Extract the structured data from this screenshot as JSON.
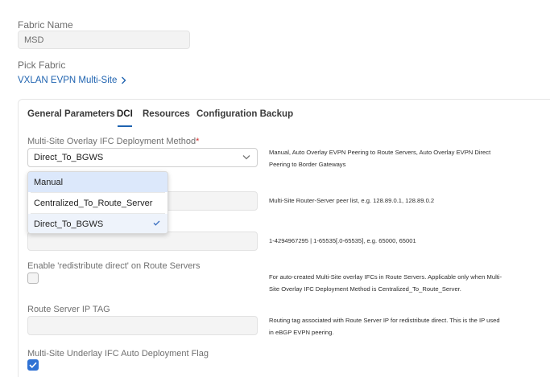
{
  "fabric": {
    "name_label": "Fabric Name",
    "name_value": "MSD",
    "pick_label": "Pick Fabric",
    "pick_link": "VXLAN EVPN Multi-Site"
  },
  "tabs": [
    {
      "label": "General Parameters"
    },
    {
      "label": "DCI"
    },
    {
      "label": "Resources"
    },
    {
      "label": "Configuration Backup"
    }
  ],
  "active_tab": "DCI",
  "fields": {
    "deploy_method": {
      "label": "Multi-Site Overlay IFC Deployment Method",
      "required_mark": "*",
      "value": "Direct_To_BGWS",
      "help": "Manual, Auto Overlay EVPN Peering to Route Servers, Auto Overlay EVPN Direct Peering to Border Gateways"
    },
    "route_server_list": {
      "help": "Multi-Site Router-Server peer list, e.g. 128.89.0.1, 128.89.0.2"
    },
    "route_server_asn": {
      "help": "1-4294967295 | 1-65535[.0-65535], e.g. 65000, 65001"
    },
    "redistribute_direct": {
      "label": "Enable 'redistribute direct' on Route Servers",
      "checked": false,
      "help": "For auto-created Multi-Site overlay IFCs in Route Servers. Applicable only when Multi-Site Overlay IFC Deployment Method is Centralized_To_Route_Server."
    },
    "route_server_ip_tag": {
      "label": "Route Server IP TAG",
      "value": "",
      "help": "Routing tag associated with Route Server IP for redistribute direct. This is the IP used in eBGP EVPN peering."
    },
    "underlay_auto_deploy": {
      "label": "Multi-Site Underlay IFC Auto Deployment Flag",
      "checked": true
    }
  },
  "dropdown": {
    "options": [
      {
        "label": "Manual"
      },
      {
        "label": "Centralized_To_Route_Server"
      },
      {
        "label": "Direct_To_BGWS"
      }
    ],
    "selected": "Direct_To_BGWS",
    "highlighted": "Manual"
  },
  "colors": {
    "accent": "#1f63b0",
    "checkbox_checked": "#2f72d4",
    "required": "#d22f2f"
  }
}
